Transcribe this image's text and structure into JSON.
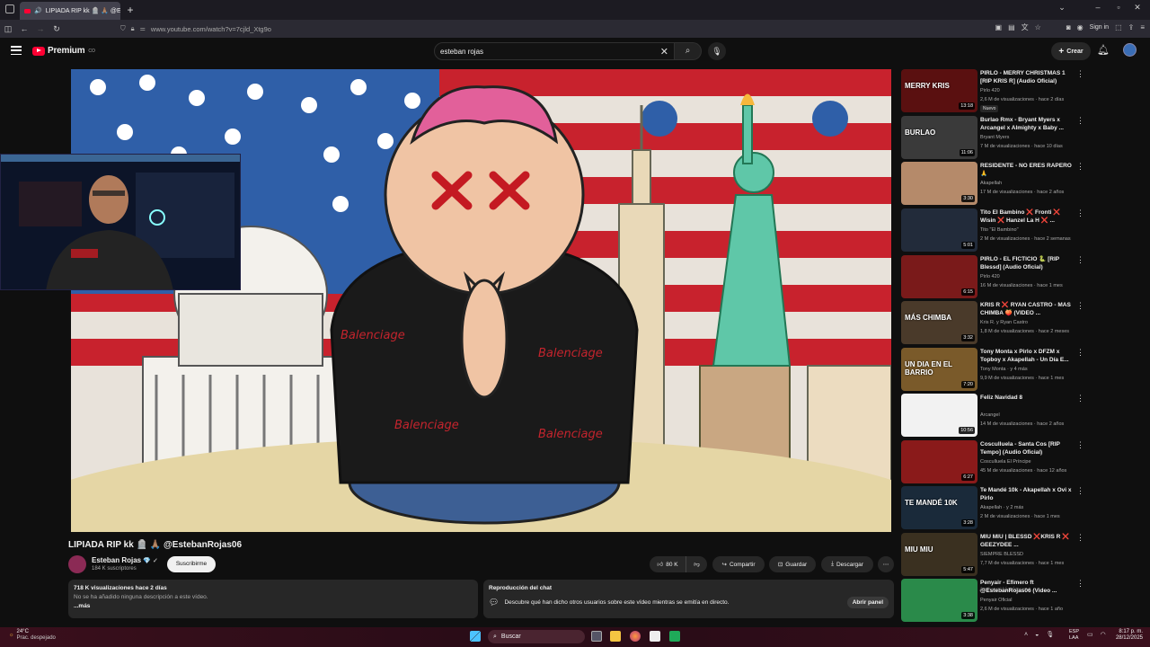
{
  "browser": {
    "tab_title": "LIPIADA RIP kk 🪦 🙏🏽 @Es",
    "url": "www.youtube.com/watch?v=7cjld_Xtg9o",
    "sign_in": "Sign in"
  },
  "header": {
    "brand": "Premium",
    "brand_sup": "CO",
    "search_value": "esteban rojas",
    "create_label": "Crear"
  },
  "video": {
    "title": "LIPIADA RIP kk 🪦 🙏🏽 @EstebanRojas06",
    "channel": "Esteban Rojas",
    "subscribers": "184 K suscriptores",
    "subscribe_label": "Suscribirme",
    "likes": "80 K",
    "share_label": "Compartir",
    "save_label": "Guardar",
    "download_label": "Descargar",
    "thumb_text": "Balenciage",
    "thumb_text_2": "BALENC..."
  },
  "description": {
    "meta": "718 K visualizaciones  hace 2 días",
    "text": "No se ha añadido ninguna descripción a este vídeo.",
    "more": "...más"
  },
  "chat": {
    "heading": "Reproducción del chat",
    "text": "Descubre qué han dicho otros usuarios sobre este vídeo mientras se emitía en directo.",
    "open_label": "Abrir panel"
  },
  "recommendations": [
    {
      "title": "PIRLO - MERRY CHRISTMAS 1 [RIP KRIS R] (Audio Oficial)",
      "channel": "Pirlo 420",
      "meta": "2,6 M de visualizaciones · hace 2 días",
      "duration": "13:18",
      "badge": "Nuevo",
      "thumb_text": "MERRY KRIS"
    },
    {
      "title": "Burlao Rmx - Bryant Myers x Arcangel x Almighty x Baby ...",
      "channel": "Bryant Myers",
      "meta": "7 M de visualizaciones · hace 10 días",
      "duration": "11:06",
      "thumb_text": "BURLAO"
    },
    {
      "title": "RESIDENTE - NO ERES RAPERO 🙏",
      "channel": "Akapellah",
      "meta": "17 M de visualizaciones · hace 2 años",
      "duration": "3:30"
    },
    {
      "title": "Tito El Bambino ❌ Fronti ❌ Wisin ❌ Hanzel La H ❌ ...",
      "channel": "Tito \"El Bambino\"",
      "meta": "2 M de visualizaciones · hace 2 semanas",
      "duration": "5:01"
    },
    {
      "title": "PIRLO - EL FICTICIO 🐍 [RIP Blessd] (Audio Oficial)",
      "channel": "Pirlo 420",
      "meta": "16 M de visualizaciones · hace 1 mes",
      "duration": "6:15"
    },
    {
      "title": "KRIS R ❌ RYAN CASTRO - MAS CHIMBA 🍑 (VIDEO ...",
      "channel": "Kris R. y Ryan Castro",
      "meta": "1,8 M de visualizaciones · hace 2 meses",
      "duration": "3:32",
      "thumb_text": "MÁS CHIMBA"
    },
    {
      "title": "Tony Monta x Pirlo x DFZM x Topboy x Akapellah - Un Día E...",
      "channel": "Tony Monta · y 4 más",
      "meta": "9,9 M de visualizaciones · hace 1 mes",
      "duration": "7:20",
      "thumb_text": "UN DIA EN EL BARRIO"
    },
    {
      "title": "Feliz Navidad 8",
      "channel": "Arcangel",
      "meta": "14 M de visualizaciones · hace 2 años",
      "duration": "10:56"
    },
    {
      "title": "Cosculluela - Santa Cos [RIP Tempo] (Audio Oficial)",
      "channel": "Cosculluela El Príncipe",
      "meta": "45 M de visualizaciones · hace 12 años",
      "duration": "6:27"
    },
    {
      "title": "Te Mandé 10k - Akapellah x Ovi x Pirlo",
      "channel": "Akapellah · y 2 más",
      "meta": "2 M de visualizaciones · hace 1 mes",
      "duration": "3:28",
      "thumb_text": "TE MANDÉ 10K"
    },
    {
      "title": "MIU MIU | BLESSD ❌KRIS R ❌ GEEZYDEE ...",
      "channel": "SIEMPRE BLESSD",
      "meta": "7,7 M de visualizaciones · hace 1 mes",
      "duration": "5:47",
      "thumb_text": "MIU MIU"
    },
    {
      "title": "Penyair - Efímero ft @EstebanRojas06 (Video ...",
      "channel": "Penyair Oficial",
      "meta": "2,6 M de visualizaciones · hace 1 año",
      "duration": "3:38"
    }
  ],
  "taskbar": {
    "temp": "24°C",
    "weather": "Prac. despejado",
    "search": "Buscar",
    "lang1": "ESP",
    "lang2": "LAA",
    "time": "8:17 p. m.",
    "date": "28/12/2025"
  },
  "watermark": "Activar Windows"
}
